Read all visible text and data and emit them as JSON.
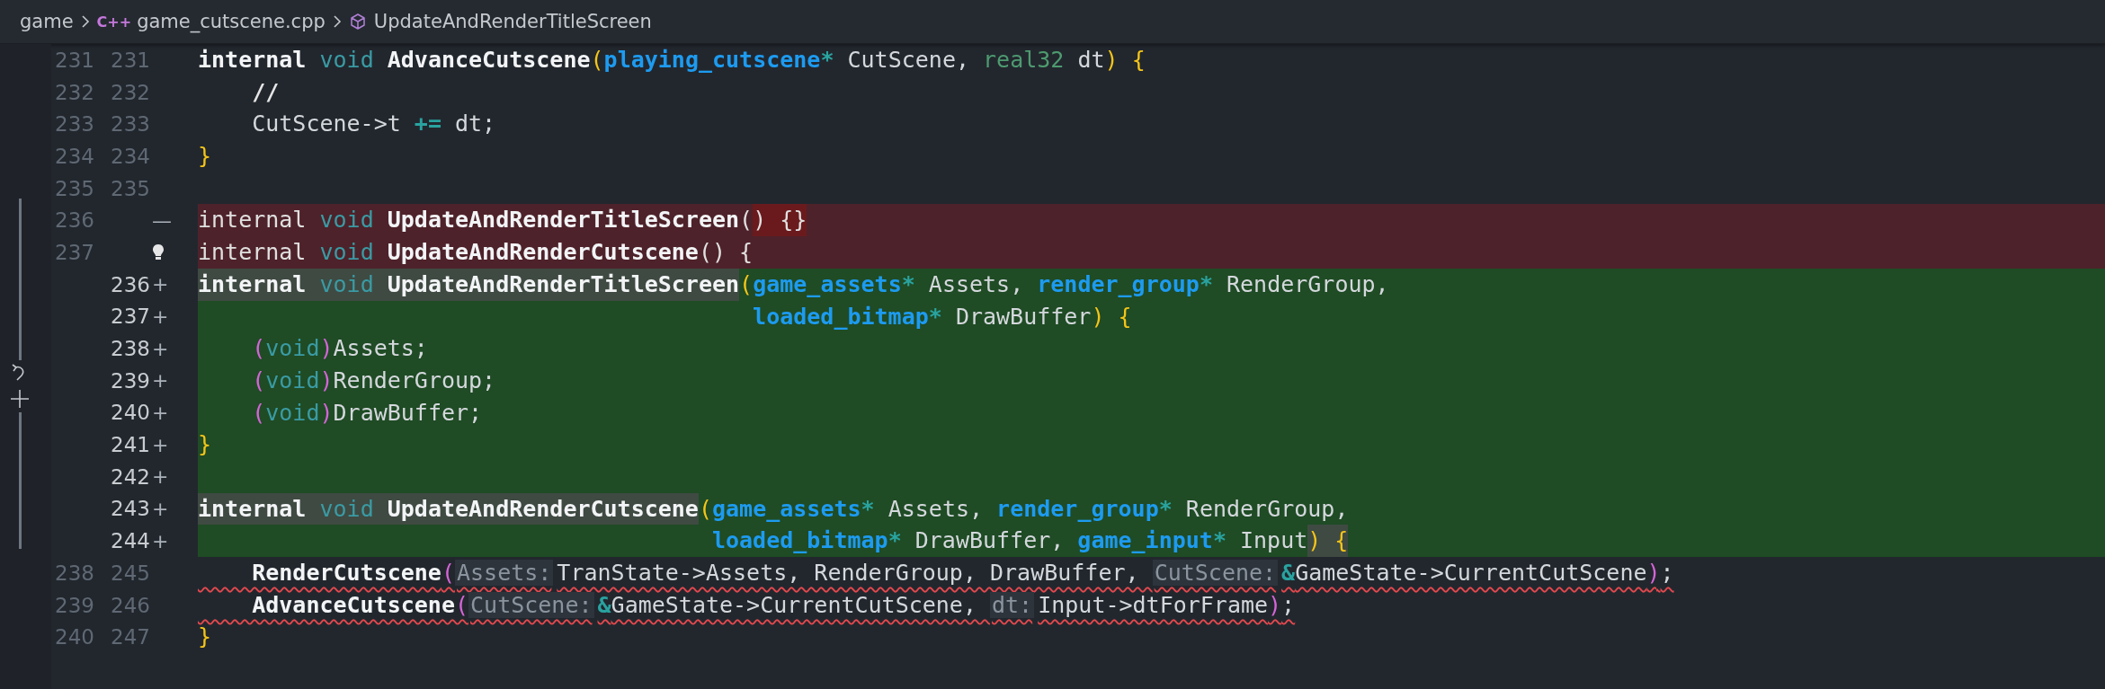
{
  "breadcrumb": [
    {
      "text": "game",
      "kind": "folder"
    },
    {
      "text": "game_cutscene.cpp",
      "kind": "file",
      "badge": "C++"
    },
    {
      "text": "UpdateAndRenderTitleScreen",
      "kind": "symbol"
    }
  ],
  "lines": [
    {
      "old": "231",
      "new": "231",
      "kind": "context",
      "error": false,
      "lightbulb": false,
      "segments": [
        {
          "marked": false,
          "tokens": [
            {
              "text": "internal",
              "kind": "keyword"
            },
            {
              "text": " void",
              "kind": "storage"
            },
            {
              "text": " AdvanceCutscene",
              "kind": "function"
            },
            {
              "text": "(",
              "kind": "bracket1"
            },
            {
              "text": "playing_cutscene",
              "kind": "type"
            },
            {
              "text": "*",
              "kind": "operator"
            },
            {
              "text": " CutScene, ",
              "kind": "plain"
            },
            {
              "text": "real32",
              "kind": "type-alt"
            },
            {
              "text": " dt",
              "kind": "plain"
            },
            {
              "text": ")",
              "kind": "bracket1"
            },
            {
              "text": " {",
              "kind": "bracket1"
            }
          ]
        }
      ]
    },
    {
      "old": "232",
      "new": "232",
      "kind": "context",
      "error": false,
      "lightbulb": false,
      "segments": [
        {
          "marked": false,
          "tokens": [
            {
              "text": "    //",
              "kind": "comment"
            }
          ]
        }
      ]
    },
    {
      "old": "233",
      "new": "233",
      "kind": "context",
      "error": false,
      "lightbulb": false,
      "segments": [
        {
          "marked": false,
          "tokens": [
            {
              "text": "    CutScene->t ",
              "kind": "plain"
            },
            {
              "text": "+=",
              "kind": "operator"
            },
            {
              "text": " dt;",
              "kind": "plain"
            }
          ]
        }
      ]
    },
    {
      "old": "234",
      "new": "234",
      "kind": "context",
      "error": false,
      "lightbulb": false,
      "segments": [
        {
          "marked": false,
          "tokens": [
            {
              "text": "}",
              "kind": "bracket1"
            }
          ]
        }
      ]
    },
    {
      "old": "235",
      "new": "235",
      "kind": "context",
      "lightbulb": false
    },
    {
      "old": "236",
      "kind": "removed",
      "sign": "—",
      "error": false,
      "lightbulb": false,
      "segments": [
        {
          "marked": false,
          "tokens": [
            {
              "text": "internal",
              "kind": "plain"
            },
            {
              "text": " void",
              "kind": "storage"
            },
            {
              "text": " UpdateAndRenderTitleScreen",
              "kind": "function"
            },
            {
              "text": "(",
              "kind": "plain"
            }
          ]
        },
        {
          "marked": true,
          "tokens": [
            {
              "text": ") {}",
              "kind": "plain"
            }
          ]
        }
      ]
    },
    {
      "old": "237",
      "kind": "removed",
      "error": false,
      "lightbulb": true,
      "segments": [
        {
          "marked": false,
          "tokens": [
            {
              "text": "internal",
              "kind": "plain"
            },
            {
              "text": " void",
              "kind": "storage"
            },
            {
              "text": " UpdateAndRenderCutscene",
              "kind": "function"
            },
            {
              "text": "() {",
              "kind": "plain"
            }
          ]
        }
      ]
    },
    {
      "new": "236",
      "kind": "added",
      "sign": "+",
      "error": false,
      "lightbulb": false,
      "segments": [
        {
          "marked": true,
          "tokens": [
            {
              "text": "internal",
              "kind": "keyword"
            },
            {
              "text": " void",
              "kind": "storage"
            },
            {
              "text": " UpdateAndRenderTitleScreen",
              "kind": "function"
            }
          ]
        },
        {
          "marked": false,
          "tokens": [
            {
              "text": "(",
              "kind": "bracket1"
            },
            {
              "text": "game_assets",
              "kind": "type"
            },
            {
              "text": "*",
              "kind": "operator"
            },
            {
              "text": " Assets, ",
              "kind": "plain"
            },
            {
              "text": "render_group",
              "kind": "type"
            },
            {
              "text": "*",
              "kind": "operator"
            },
            {
              "text": " RenderGroup,",
              "kind": "plain"
            }
          ]
        }
      ]
    },
    {
      "new": "237",
      "kind": "added",
      "sign": "+",
      "error": false,
      "lightbulb": false,
      "segments": [
        {
          "marked": false,
          "tokens": [
            {
              "text": "                                         loaded_bitmap",
              "kind": "type"
            },
            {
              "text": "*",
              "kind": "operator"
            },
            {
              "text": " DrawBuffer",
              "kind": "plain"
            },
            {
              "text": ")",
              "kind": "bracket1"
            },
            {
              "text": " {",
              "kind": "bracket1"
            }
          ]
        }
      ]
    },
    {
      "new": "238",
      "kind": "added",
      "sign": "+",
      "error": false,
      "lightbulb": false,
      "segments": [
        {
          "marked": false,
          "tokens": [
            {
              "text": "    (",
              "kind": "bracket2"
            },
            {
              "text": "void",
              "kind": "storage"
            },
            {
              "text": ")",
              "kind": "bracket2"
            },
            {
              "text": "Assets;",
              "kind": "plain"
            }
          ]
        }
      ]
    },
    {
      "new": "239",
      "kind": "added",
      "sign": "+",
      "error": false,
      "lightbulb": false,
      "segments": [
        {
          "marked": false,
          "tokens": [
            {
              "text": "    (",
              "kind": "bracket2"
            },
            {
              "text": "void",
              "kind": "storage"
            },
            {
              "text": ")",
              "kind": "bracket2"
            },
            {
              "text": "RenderGroup;",
              "kind": "plain"
            }
          ]
        }
      ]
    },
    {
      "new": "240",
      "kind": "added",
      "sign": "+",
      "error": false,
      "lightbulb": false,
      "segments": [
        {
          "marked": false,
          "tokens": [
            {
              "text": "    (",
              "kind": "bracket2"
            },
            {
              "text": "void",
              "kind": "storage"
            },
            {
              "text": ")",
              "kind": "bracket2"
            },
            {
              "text": "DrawBuffer;",
              "kind": "plain"
            }
          ]
        }
      ]
    },
    {
      "new": "241",
      "kind": "added",
      "sign": "+",
      "error": false,
      "lightbulb": false,
      "segments": [
        {
          "marked": false,
          "tokens": [
            {
              "text": "}",
              "kind": "bracket1"
            }
          ]
        }
      ]
    },
    {
      "new": "242",
      "kind": "added",
      "sign": "+",
      "lightbulb": false
    },
    {
      "new": "243",
      "kind": "added",
      "sign": "+",
      "error": false,
      "lightbulb": false,
      "segments": [
        {
          "marked": true,
          "tokens": [
            {
              "text": "internal",
              "kind": "keyword"
            },
            {
              "text": " void",
              "kind": "storage"
            },
            {
              "text": " UpdateAndRenderCutscene",
              "kind": "function"
            }
          ]
        },
        {
          "marked": false,
          "tokens": [
            {
              "text": "(",
              "kind": "bracket1"
            },
            {
              "text": "game_assets",
              "kind": "type"
            },
            {
              "text": "*",
              "kind": "operator"
            },
            {
              "text": " Assets, ",
              "kind": "plain"
            },
            {
              "text": "render_group",
              "kind": "type"
            },
            {
              "text": "*",
              "kind": "operator"
            },
            {
              "text": " RenderGroup,",
              "kind": "plain"
            }
          ]
        }
      ]
    },
    {
      "new": "244",
      "kind": "added",
      "sign": "+",
      "error": false,
      "lightbulb": false,
      "segments": [
        {
          "marked": false,
          "tokens": [
            {
              "text": "                                      loaded_bitmap",
              "kind": "type"
            },
            {
              "text": "*",
              "kind": "operator"
            },
            {
              "text": " DrawBuffer, ",
              "kind": "plain"
            },
            {
              "text": "game_input",
              "kind": "type"
            },
            {
              "text": "*",
              "kind": "operator"
            },
            {
              "text": " Input",
              "kind": "plain"
            }
          ]
        },
        {
          "marked": true,
          "tokens": [
            {
              "text": ")",
              "kind": "bracket1"
            },
            {
              "text": " {",
              "kind": "bracket1"
            }
          ]
        }
      ]
    },
    {
      "old": "238",
      "new": "245",
      "kind": "context",
      "error": true,
      "lightbulb": false,
      "segments": [
        {
          "marked": false,
          "tokens": [
            {
              "text": "    RenderCutscene",
              "kind": "function"
            },
            {
              "text": "(",
              "kind": "bracket2"
            },
            {
              "text": "Assets:",
              "kind": "hint"
            },
            {
              "text": "TranState->Assets, RenderGroup, DrawBuffer, ",
              "kind": "plain"
            },
            {
              "text": "CutScene:",
              "kind": "hint"
            },
            {
              "text": "&",
              "kind": "operator"
            },
            {
              "text": "GameState->CurrentCutScene",
              "kind": "plain"
            },
            {
              "text": ")",
              "kind": "bracket2"
            },
            {
              "text": ";",
              "kind": "plain"
            }
          ]
        }
      ]
    },
    {
      "old": "239",
      "new": "246",
      "kind": "context",
      "error": true,
      "lightbulb": false,
      "segments": [
        {
          "marked": false,
          "tokens": [
            {
              "text": "    AdvanceCutscene",
              "kind": "function"
            },
            {
              "text": "(",
              "kind": "bracket2"
            },
            {
              "text": "CutScene:",
              "kind": "hint"
            },
            {
              "text": "&",
              "kind": "operator"
            },
            {
              "text": "GameState->CurrentCutScene, ",
              "kind": "plain"
            },
            {
              "text": "dt:",
              "kind": "hint"
            },
            {
              "text": "Input->dtForFrame",
              "kind": "plain"
            },
            {
              "text": ")",
              "kind": "bracket2"
            },
            {
              "text": ";",
              "kind": "plain"
            }
          ]
        }
      ]
    },
    {
      "old": "240",
      "new": "247",
      "kind": "context",
      "error": false,
      "lightbulb": false,
      "segments": [
        {
          "marked": false,
          "tokens": [
            {
              "text": "}",
              "kind": "bracket1"
            }
          ]
        }
      ]
    }
  ]
}
